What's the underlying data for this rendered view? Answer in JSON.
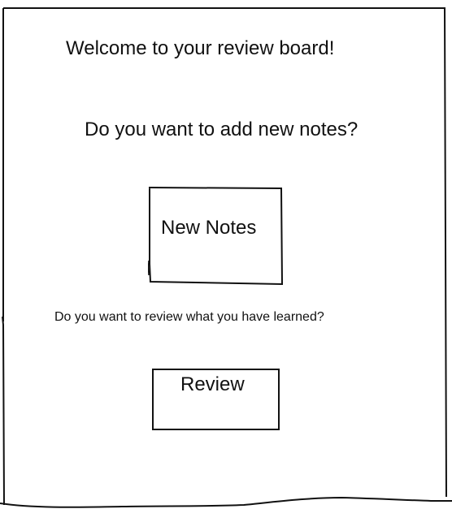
{
  "board": {
    "welcome": "Welcome to your review board!",
    "add_notes_question": "Do you want to add new notes?",
    "new_notes_button": "New Notes",
    "review_question": "Do you want to review what you have learned?",
    "review_button": "Review"
  },
  "colors": {
    "ink": "#111111",
    "background": "#ffffff"
  }
}
